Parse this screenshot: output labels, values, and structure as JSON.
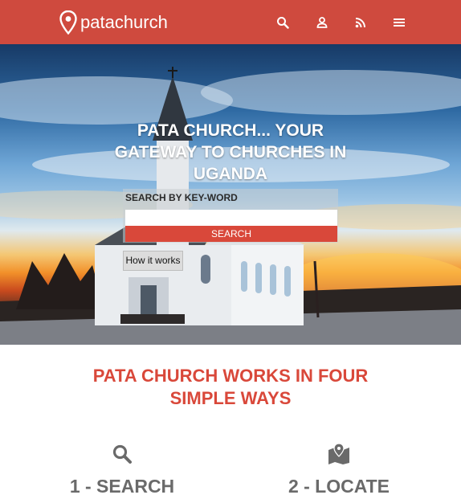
{
  "header": {
    "brand": "patachurch",
    "icons": [
      "map-pin-logo-icon",
      "search-icon",
      "user-icon",
      "rss-icon",
      "menu-icon"
    ],
    "color": "#cf4a3e"
  },
  "hero": {
    "title": "PATA CHURCH... YOUR GATEWAY TO CHURCHES IN UGANDA",
    "search": {
      "label": "SEARCH BY KEY-WORD",
      "value": "",
      "placeholder": "",
      "button_label": "SEARCH"
    },
    "how_it_works_label": "How it works"
  },
  "section": {
    "title": "PATA CHURCH WORKS IN FOUR SIMPLE WAYS",
    "accent": "#d9483a",
    "steps": [
      {
        "label": "1 - SEARCH",
        "icon": "search-icon"
      },
      {
        "label": "2 - LOCATE",
        "icon": "map-icon"
      }
    ]
  }
}
